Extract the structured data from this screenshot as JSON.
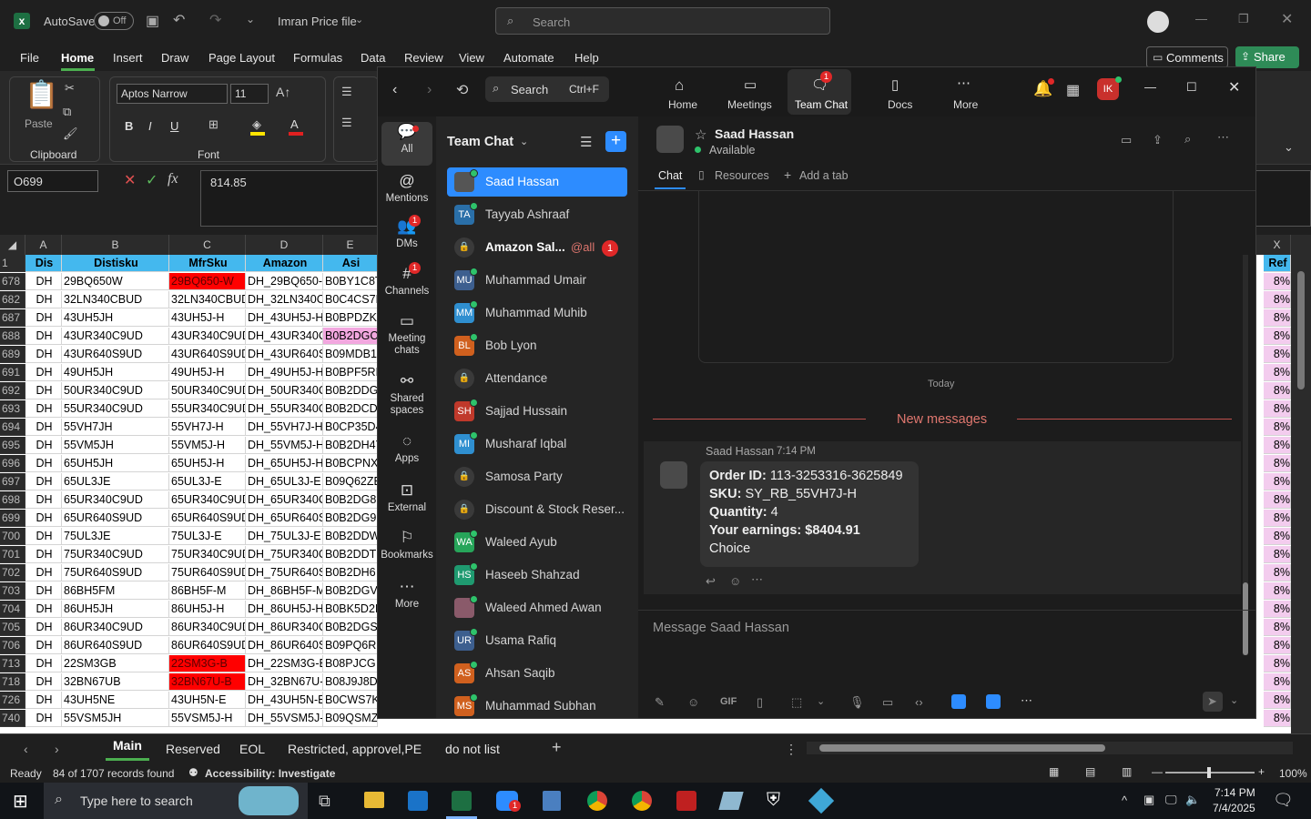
{
  "excel": {
    "autosave_label": "AutoSave",
    "autosave_state": "Off",
    "file_name": "Imran Price file",
    "search_placeholder": "Search",
    "menu": [
      "File",
      "Home",
      "Insert",
      "Draw",
      "Page Layout",
      "Formulas",
      "Data",
      "Review",
      "View",
      "Automate",
      "Help"
    ],
    "comments_label": "Comments",
    "share_label": "Share",
    "ribbon": {
      "paste_label": "Paste",
      "clipboard_label": "Clipboard",
      "font_name": "Aptos Narrow",
      "font_size": "11",
      "font_label": "Font",
      "bold": "B",
      "italic": "I",
      "underline": "U"
    },
    "name_box": "O699",
    "formula_value": "814.85",
    "col_letters": [
      "A",
      "B",
      "C",
      "D",
      "E",
      "X"
    ],
    "headers": [
      "Dis",
      "Distisku",
      "MfrSku",
      "Amazon",
      "Asi",
      "Ref"
    ],
    "rows": [
      {
        "n": "1"
      },
      {
        "n": "678",
        "a": "DH",
        "b": "29BQ650W",
        "c": "29BQ650-W",
        "d": "DH_29BQ650-",
        "e": "B0BY1C8T",
        "x": "8%",
        "c_red": true
      },
      {
        "n": "682",
        "a": "DH",
        "b": "32LN340CBUD",
        "c": "32LN340CBUD",
        "d": "DH_32LN340C",
        "e": "B0C4CS7L",
        "x": "8%"
      },
      {
        "n": "687",
        "a": "DH",
        "b": "43UH5JH",
        "c": "43UH5J-H",
        "d": "DH_43UH5J-H",
        "e": "B0BPDZK",
        "x": "8%"
      },
      {
        "n": "688",
        "a": "DH",
        "b": "43UR340C9UD",
        "c": "43UR340C9UD",
        "d": "DH_43UR340C",
        "e": "B0B2DGC",
        "x": "8%",
        "e_pink": true
      },
      {
        "n": "689",
        "a": "DH",
        "b": "43UR640S9UD",
        "c": "43UR640S9UD",
        "d": "DH_43UR640S",
        "e": "B09MDB1",
        "x": "8%"
      },
      {
        "n": "691",
        "a": "DH",
        "b": "49UH5JH",
        "c": "49UH5J-H",
        "d": "DH_49UH5J-H",
        "e": "B0BPF5RF",
        "x": "8%"
      },
      {
        "n": "692",
        "a": "DH",
        "b": "50UR340C9UD",
        "c": "50UR340C9UD",
        "d": "DH_50UR340C",
        "e": "B0B2DDG",
        "x": "8%"
      },
      {
        "n": "693",
        "a": "DH",
        "b": "55UR340C9UD",
        "c": "55UR340C9UD",
        "d": "DH_55UR340C",
        "e": "B0B2DCD",
        "x": "8%"
      },
      {
        "n": "694",
        "a": "DH",
        "b": "55VH7JH",
        "c": "55VH7J-H",
        "d": "DH_55VH7J-H",
        "e": "B0CP35D4",
        "x": "8%"
      },
      {
        "n": "695",
        "a": "DH",
        "b": "55VM5JH",
        "c": "55VM5J-H",
        "d": "DH_55VM5J-H",
        "e": "B0B2DH4Y",
        "x": "8%"
      },
      {
        "n": "696",
        "a": "DH",
        "b": "65UH5JH",
        "c": "65UH5J-H",
        "d": "DH_65UH5J-H",
        "e": "B0BCPNX",
        "x": "8%"
      },
      {
        "n": "697",
        "a": "DH",
        "b": "65UL3JE",
        "c": "65UL3J-E",
        "d": "DH_65UL3J-E",
        "e": "B09Q62ZE",
        "x": "8%"
      },
      {
        "n": "698",
        "a": "DH",
        "b": "65UR340C9UD",
        "c": "65UR340C9UD",
        "d": "DH_65UR340C",
        "e": "B0B2DG8",
        "x": "8%"
      },
      {
        "n": "699",
        "a": "DH",
        "b": "65UR640S9UD",
        "c": "65UR640S9UD",
        "d": "DH_65UR640S",
        "e": "B0B2DG9",
        "x": "8%"
      },
      {
        "n": "700",
        "a": "DH",
        "b": "75UL3JE",
        "c": "75UL3J-E",
        "d": "DH_75UL3J-E",
        "e": "B0B2DDW",
        "x": "8%"
      },
      {
        "n": "701",
        "a": "DH",
        "b": "75UR340C9UD",
        "c": "75UR340C9UD",
        "d": "DH_75UR340C",
        "e": "B0B2DDT",
        "x": "8%"
      },
      {
        "n": "702",
        "a": "DH",
        "b": "75UR640S9UD",
        "c": "75UR640S9UD",
        "d": "DH_75UR640S",
        "e": "B0B2DH6",
        "x": "8%"
      },
      {
        "n": "703",
        "a": "DH",
        "b": "86BH5FM",
        "c": "86BH5F-M",
        "d": "DH_86BH5F-M",
        "e": "B0B2DGV",
        "x": "8%"
      },
      {
        "n": "704",
        "a": "DH",
        "b": "86UH5JH",
        "c": "86UH5J-H",
        "d": "DH_86UH5J-H",
        "e": "B0BK5D2I",
        "x": "8%"
      },
      {
        "n": "705",
        "a": "DH",
        "b": "86UR340C9UD",
        "c": "86UR340C9UD",
        "d": "DH_86UR340C",
        "e": "B0B2DGS",
        "x": "8%"
      },
      {
        "n": "706",
        "a": "DH",
        "b": "86UR640S9UD",
        "c": "86UR640S9UD",
        "d": "DH_86UR640S",
        "e": "B09PQ6R",
        "x": "8%"
      },
      {
        "n": "713",
        "a": "DH",
        "b": "22SM3GB",
        "c": "22SM3G-B",
        "d": "DH_22SM3G-B",
        "e": "B08PJCG",
        "x": "8%",
        "c_red": true
      },
      {
        "n": "718",
        "a": "DH",
        "b": "32BN67UB",
        "c": "32BN67U-B",
        "d": "DH_32BN67U-",
        "e": "B08J9J8D",
        "x": "8%",
        "c_red": true
      },
      {
        "n": "726",
        "a": "DH",
        "b": "43UH5NE",
        "c": "43UH5N-E",
        "d": "DH_43UH5N-E",
        "e": "B0CWS7K",
        "x": "8%"
      },
      {
        "n": "740",
        "a": "DH",
        "b": "55VSM5JH",
        "c": "55VSM5J-H",
        "d": "DH_55VSM5J-",
        "e": "B09QSMZ",
        "x": "8%"
      }
    ],
    "sheets": [
      "Main",
      "Reserved",
      "EOL",
      "Restricted, approvel,PE",
      "do not list"
    ],
    "status_ready": "Ready",
    "status_records": "84 of 1707 records found",
    "status_accessibility": "Accessibility: Investigate",
    "zoom_level": "100%"
  },
  "taskbar": {
    "search_placeholder": "Type here to search",
    "time": "7:14 PM",
    "date": "7/4/2025",
    "zoom_badge": "1"
  },
  "zoom": {
    "search_label": "Search",
    "search_shortcut": "Ctrl+F",
    "nav": [
      {
        "label": "Home",
        "icon": "home-icon"
      },
      {
        "label": "Meetings",
        "icon": "camera-icon"
      },
      {
        "label": "Team Chat",
        "icon": "chat-icon",
        "badge": "1"
      },
      {
        "label": "Docs",
        "icon": "doc-icon"
      },
      {
        "label": "More",
        "icon": "more-icon"
      }
    ],
    "avatar_initials": "IK",
    "rail": [
      {
        "label": "All",
        "icon": "💬"
      },
      {
        "label": "Mentions",
        "icon": "@"
      },
      {
        "label": "DMs",
        "icon": "👥",
        "badge": "1"
      },
      {
        "label": "Channels",
        "icon": "#",
        "badge": "1"
      },
      {
        "label": "Meeting chats",
        "icon": "▭"
      },
      {
        "label": "Shared spaces",
        "icon": "⚯"
      },
      {
        "label": "Apps",
        "icon": "◌"
      },
      {
        "label": "External",
        "icon": "⊡"
      },
      {
        "label": "Bookmarks",
        "icon": "⚐"
      },
      {
        "label": "More",
        "icon": "⋯"
      }
    ],
    "list_title": "Team Chat",
    "chats": [
      {
        "name": "Saad Hassan",
        "initials": "",
        "color": "#555",
        "active": true
      },
      {
        "name": "Tayyab Ashraaf",
        "initials": "TA",
        "color": "#2a6fa8"
      },
      {
        "name": "Amazon Sal...",
        "initials": "",
        "color": "#444",
        "locked": true,
        "mention": "@all",
        "badge": "1",
        "bold": true
      },
      {
        "name": "Muhammad Umair",
        "initials": "MU",
        "color": "#3d5f8f"
      },
      {
        "name": "Muhammad Muhib",
        "initials": "MM",
        "color": "#2f8fd0"
      },
      {
        "name": "Bob Lyon",
        "initials": "BL",
        "color": "#d0601e"
      },
      {
        "name": "Attendance",
        "initials": "",
        "color": "#444",
        "locked": true
      },
      {
        "name": "Sajjad Hussain",
        "initials": "SH",
        "color": "#c0392b"
      },
      {
        "name": "Musharaf Iqbal",
        "initials": "MI",
        "color": "#2f8fd0"
      },
      {
        "name": "Samosa Party",
        "initials": "",
        "color": "#444",
        "locked": true
      },
      {
        "name": "Discount & Stock Reser...",
        "initials": "",
        "color": "#444",
        "locked": true
      },
      {
        "name": "Waleed Ayub",
        "initials": "WA",
        "color": "#27a55a"
      },
      {
        "name": "Haseeb Shahzad",
        "initials": "HS",
        "color": "#1f9a70"
      },
      {
        "name": "Waleed Ahmed Awan",
        "initials": "",
        "color": "#8a5a6a"
      },
      {
        "name": "Usama Rafiq",
        "initials": "UR",
        "color": "#3d5f8f"
      },
      {
        "name": "Ahsan Saqib",
        "initials": "AS",
        "color": "#d0601e"
      },
      {
        "name": "Muhammad Subhan",
        "initials": "MS",
        "color": "#d0601e"
      }
    ],
    "contact_name": "Saad Hassan",
    "contact_status": "Available",
    "tabs": [
      "Chat",
      "Resources",
      "Add a tab"
    ],
    "day_divider": "Today",
    "new_messages": "New messages",
    "message": {
      "sender": "Saad Hassan",
      "time": "7:14 PM",
      "order_label": "Order ID:",
      "order_value": "113-3253316-3625849",
      "sku_label": "SKU:",
      "sku_value": "SY_RB_55VH7J-H",
      "qty_label": "Quantity:",
      "qty_value": "4",
      "earn_label": "Your earnings:",
      "earn_value": "$8404.91",
      "extra": "Choice"
    },
    "compose_placeholder": "Message Saad Hassan",
    "gif_label": "GIF"
  }
}
